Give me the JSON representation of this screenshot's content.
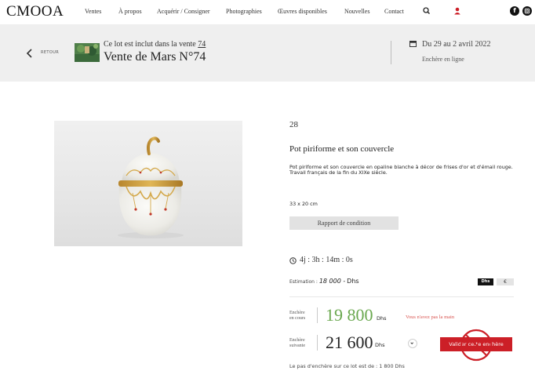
{
  "brand": {
    "logo": "CMOOA"
  },
  "nav": {
    "items": [
      "Ventes",
      "À propos",
      "Acquérir / Consigner",
      "Photographies",
      "Œuvres disponibles",
      "Nouvelles",
      "Contact"
    ],
    "icons": [
      "search-icon",
      "user-icon",
      "facebook-icon",
      "instagram-icon"
    ],
    "user_icon_color": "#cc1f27",
    "facebook_glyph": "f"
  },
  "sale": {
    "back_label": "RETOUR",
    "included_prefix": "Ce lot est inclut dans la vente",
    "sale_number": "74",
    "title": "Vente de Mars N°74",
    "dates": "Du 29 au 2 avril 2022",
    "type": "Enchère en ligne"
  },
  "lot": {
    "number": "28",
    "title": "Pot piriforme et son couvercle",
    "description_line1": "Pot piriforme et son couvercle en opaline blanche à décor de frises d'or et d'émail rouge.",
    "description_line2": "Travail français de la fin du XIXe siècle.",
    "dimensions": "33 x 20 cm",
    "report_button": "Rapport de condition"
  },
  "auction": {
    "countdown": "4j : 3h : 14m : 0s",
    "estimate_label": "Estimation :",
    "estimate_value": "18 000 -",
    "estimate_currency": "Dhs",
    "currency_active": "Dhs",
    "currency_alt": "€",
    "current_bid_label_1": "Enchère",
    "current_bid_label_2": "en cours",
    "current_bid": "19 800",
    "current_bid_currency": "Dhs",
    "outbid_note": "Vous n'avez pas la main",
    "next_bid_label_1": "Enchère",
    "next_bid_label_2": "suivante",
    "next_bid": "21 600",
    "next_bid_currency": "Dhs",
    "validate_button": "Valider cette enchère",
    "increment_note": "Le pas d'enchère sur ce lot est de : 1 800 Dhs"
  },
  "colors": {
    "accent_red": "#cc1f27",
    "bid_green": "#6aa84f",
    "band_gray": "#efefef"
  }
}
